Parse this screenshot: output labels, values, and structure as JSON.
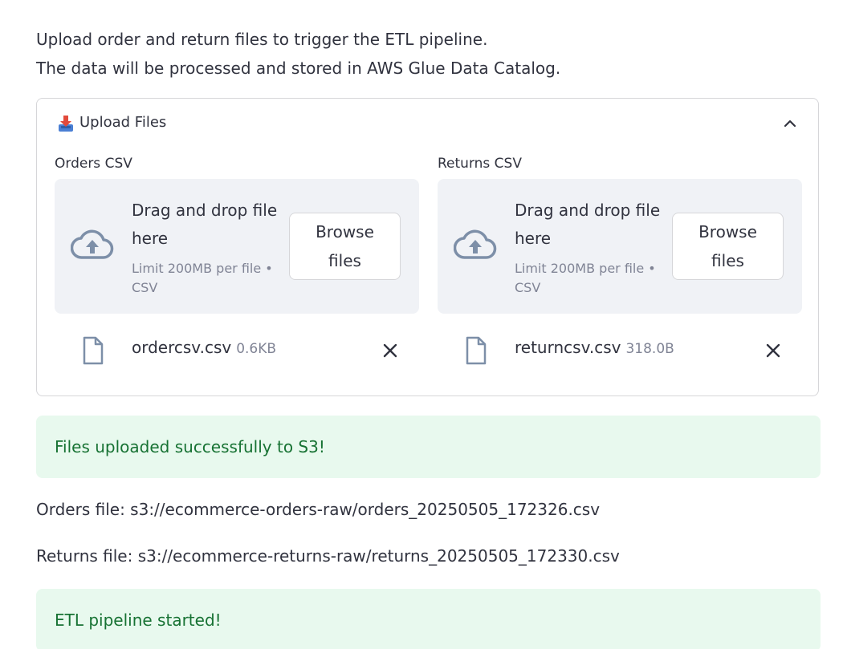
{
  "intro": {
    "line1": "Upload order and return files to trigger the ETL pipeline.",
    "line2": "The data will be processed and stored in AWS Glue Data Catalog."
  },
  "expander": {
    "title": "Upload Files",
    "icon": "inbox-tray-emoji",
    "expanded": true
  },
  "uploaders": [
    {
      "label": "Orders CSV",
      "dropzone_text": "Drag and drop file here",
      "limit_text": "Limit 200MB per file • CSV",
      "browse_label": "Browse files",
      "file": {
        "name": "ordercsv.csv",
        "size": "0.6KB"
      }
    },
    {
      "label": "Returns CSV",
      "dropzone_text": "Drag and drop file here",
      "limit_text": "Limit 200MB per file • CSV",
      "browse_label": "Browse files",
      "file": {
        "name": "returncsv.csv",
        "size": "318.0B"
      }
    }
  ],
  "upload_success": "Files uploaded successfully to S3!",
  "orders_path": "Orders file: s3://ecommerce-orders-raw/orders_20250505_172326.csv",
  "returns_path": "Returns file: s3://ecommerce-returns-raw/returns_20250505_172330.csv",
  "etl_status": "ETL pipeline started!",
  "colors": {
    "success_bg": "#e8f9ee",
    "success_text": "#177233",
    "dropzone_bg": "#f0f2f6",
    "muted_text": "#808495",
    "body_text": "#31333f"
  }
}
